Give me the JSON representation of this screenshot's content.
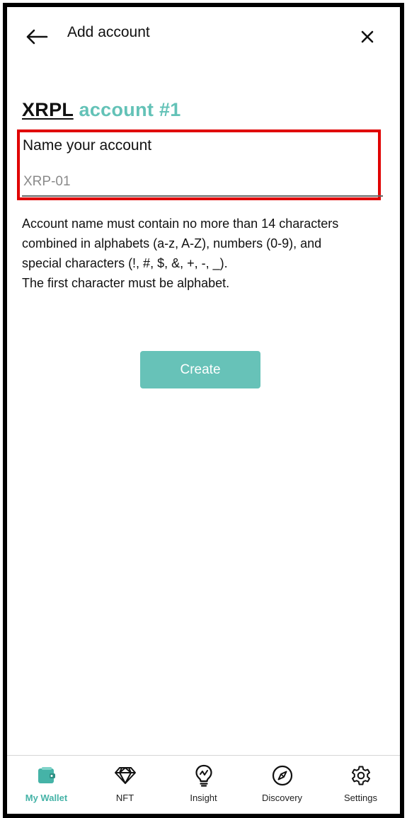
{
  "header": {
    "title": "Add account",
    "back_icon": "arrow-left-icon",
    "close_icon": "close-icon"
  },
  "heading": {
    "network": "XRPL",
    "account": "account #1"
  },
  "form": {
    "label": "Name your account",
    "input_value": "",
    "input_placeholder": "XRP-01",
    "helper_lines": [
      "Account name must contain no more than 14 characters",
      "combined in alphabets (a-z, A-Z), numbers (0-9), and",
      "special characters (!, #, $, &, +, -, _).",
      "The first character must be alphabet."
    ],
    "create_label": "Create"
  },
  "nav": {
    "items": [
      {
        "label": "My Wallet",
        "icon": "wallet-icon",
        "active": true
      },
      {
        "label": "NFT",
        "icon": "diamond-icon",
        "active": false
      },
      {
        "label": "Insight",
        "icon": "lightbulb-icon",
        "active": false
      },
      {
        "label": "Discovery",
        "icon": "compass-icon",
        "active": false
      },
      {
        "label": "Settings",
        "icon": "gear-icon",
        "active": false
      }
    ]
  },
  "colors": {
    "accent": "#63c2b7",
    "button": "#67c2b8",
    "highlight": "#e00000",
    "nav_active": "#45b3a7"
  }
}
